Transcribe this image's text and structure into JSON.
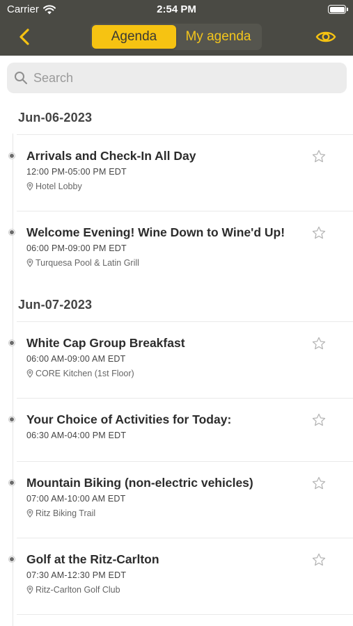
{
  "status_bar": {
    "carrier": "Carrier",
    "time": "2:54 PM"
  },
  "nav": {
    "tabs": [
      {
        "label": "Agenda",
        "active": true
      },
      {
        "label": "My agenda",
        "active": false
      }
    ],
    "accent_color": "#f6c312"
  },
  "search": {
    "placeholder": "Search",
    "value": ""
  },
  "sections": [
    {
      "date": "Jun-06-2023",
      "events": [
        {
          "title": "Arrivals and Check-In All Day",
          "time": "12:00 PM-05:00 PM EDT",
          "location": "Hotel Lobby"
        },
        {
          "title": "Welcome Evening! Wine Down to Wine'd Up!",
          "time": "06:00 PM-09:00 PM EDT",
          "location": "Turquesa Pool & Latin Grill"
        }
      ]
    },
    {
      "date": "Jun-07-2023",
      "events": [
        {
          "title": "White Cap Group Breakfast",
          "time": "06:00 AM-09:00 AM EDT",
          "location": "CORE Kitchen (1st Floor)"
        },
        {
          "title": "Your Choice of Activities for Today:",
          "time": "06:30 AM-04:00 PM EDT",
          "location": ""
        },
        {
          "title": "Mountain Biking (non-electric vehicles)",
          "time": "07:00 AM-10:00 AM EDT",
          "location": "Ritz Biking Trail"
        },
        {
          "title": "Golf at the Ritz-Carlton",
          "time": "07:30 AM-12:30 PM EDT",
          "location": "Ritz-Carlton Golf Club"
        }
      ]
    }
  ]
}
